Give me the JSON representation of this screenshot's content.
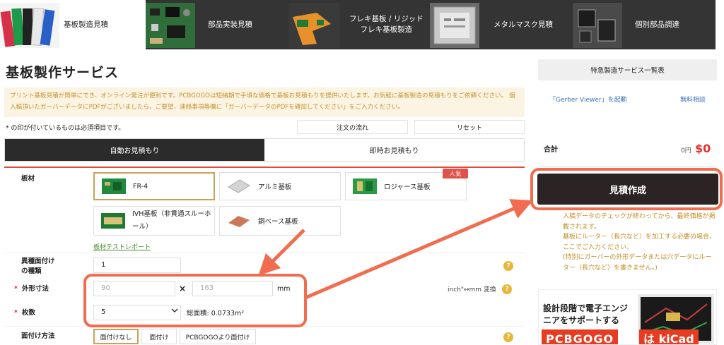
{
  "topnav": {
    "tabs": [
      {
        "label": "基板製造見積"
      },
      {
        "label": "部品実装見積"
      },
      {
        "label_line1": "フレキ基板 / リジッド",
        "label_line2": "フレキ基板製造"
      },
      {
        "label": "メタルマスク見積"
      },
      {
        "label": "個別部品調達"
      }
    ]
  },
  "main": {
    "title": "基板製作サービス",
    "notice": "プリント基板見積が簡単にでき、オンライン発注が便利です。PCBGOGOは短納期で手頃な価格で基板お見積もりを提供いたします。お気軽に基板製造の見積もりをご依頼ください。 個入稿頂いたガーバーデータにPDFがございましたら、ご要望、連絡事項等欄に「ガーバーデータのPDFを確認してください」をご入力ください。",
    "required_note": "* の印が付いているものは必須項目です。",
    "flow_button": "注文の流れ",
    "reset_button": "リセット",
    "modes": [
      "自動お見積もり",
      "即時お見積もり"
    ],
    "material": {
      "label": "板材",
      "options": [
        "FR-4",
        "アルミ基板",
        "ロジャース基板",
        "IVH基板（非貫通スルーホール）",
        "銅ベース基板"
      ],
      "badge": "人気",
      "report_link": "板材テストレポート"
    },
    "mixed": {
      "label_line1": "異種面付け",
      "label_line2": "の種類",
      "value": "1"
    },
    "size": {
      "label": "外形寸法",
      "width": "90",
      "height": "163",
      "times": "×",
      "unit": "mm",
      "convert": "inch\"↔mm 変換"
    },
    "qty": {
      "label": "枚数",
      "value": "5",
      "area": "総面積: 0.0733m²"
    },
    "panel": {
      "label": "面付け方法",
      "options": [
        "面付けなし",
        "面付け",
        "PCBGOGOより面付け"
      ]
    },
    "required_mark": "*",
    "help_mark": "?"
  },
  "right": {
    "header": "特急製造サービス一覧表",
    "gerber_link": "「Gerber Viewer」を起動",
    "free_consult": "無料相談",
    "total_label": "合計",
    "total_yen": "0円",
    "total_usd": "$0",
    "quote_button": "見積作成",
    "note": [
      "入稿データのチェックが終わってから、最終価格が掲載されます。",
      "基板にルーター（長穴など）を加工する必要の場合、ここでご入力ください。",
      "(特別にガーバーの外形データまたは穴データにルーター（長穴など）を書きません。)"
    ],
    "banner": {
      "line1": "設計段階で電子エンジ",
      "line2": "ニアをサポートする",
      "brand": "PCBGOGO",
      "suffix": "は kiCad"
    }
  },
  "colors": {
    "accent_red": "#e04b3a",
    "notice_text": "#c4912f",
    "gold": "#c9a258",
    "price_red": "#e0302a"
  }
}
